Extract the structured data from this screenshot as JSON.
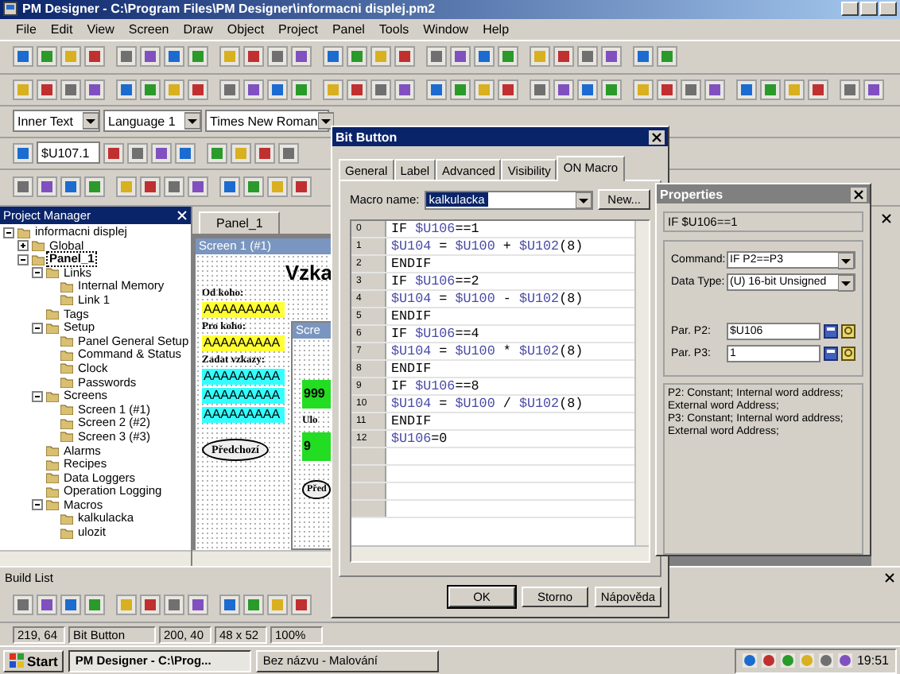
{
  "window": {
    "title": "PM Designer - C:\\Program Files\\PM Designer\\informacni displej.pm2"
  },
  "menu": [
    "File",
    "Edit",
    "View",
    "Screen",
    "Draw",
    "Object",
    "Project",
    "Panel",
    "Tools",
    "Window",
    "Help"
  ],
  "format_bar": {
    "text_target": "Inner Text",
    "language": "Language 1",
    "font": "Times New Roman"
  },
  "address_field": {
    "value": "$U107.1"
  },
  "project_manager": {
    "title": "Project Manager",
    "tree": [
      {
        "label": "informacni displej",
        "expanded": true,
        "selected": false,
        "children": [
          {
            "label": "Global",
            "expanded": false,
            "selected": false
          },
          {
            "label": "Panel_1",
            "expanded": true,
            "selected": true,
            "children": [
              {
                "label": "Links",
                "expanded": true,
                "selected": false,
                "children": [
                  {
                    "label": "Internal Memory",
                    "selected": false
                  },
                  {
                    "label": "Link 1",
                    "selected": false
                  }
                ]
              },
              {
                "label": "Tags",
                "selected": false
              },
              {
                "label": "Setup",
                "expanded": true,
                "selected": false,
                "children": [
                  {
                    "label": "Panel General Setup",
                    "selected": false
                  },
                  {
                    "label": "Command & Status",
                    "selected": false
                  },
                  {
                    "label": "Clock",
                    "selected": false
                  },
                  {
                    "label": "Passwords",
                    "selected": false
                  }
                ]
              },
              {
                "label": "Screens",
                "expanded": true,
                "selected": false,
                "children": [
                  {
                    "label": "Screen 1 (#1)",
                    "selected": false
                  },
                  {
                    "label": "Screen 2 (#2)",
                    "selected": false
                  },
                  {
                    "label": "Screen 3 (#3)",
                    "selected": false
                  }
                ]
              },
              {
                "label": "Alarms",
                "selected": false
              },
              {
                "label": "Recipes",
                "selected": false
              },
              {
                "label": "Data Loggers",
                "selected": false
              },
              {
                "label": "Operation Logging",
                "selected": false
              },
              {
                "label": "Macros",
                "expanded": true,
                "selected": false,
                "children": [
                  {
                    "label": "kalkulacka",
                    "selected": false
                  },
                  {
                    "label": "ulozit",
                    "selected": false
                  }
                ]
              }
            ]
          }
        ]
      }
    ]
  },
  "editor": {
    "tab": "Panel_1",
    "screen_title": "Screen 1 (#1)",
    "heading": "Vzka",
    "items": [
      {
        "kind": "label",
        "text": "Od koho:"
      },
      {
        "kind": "field",
        "text": "AAAAAAAAA",
        "color": "#ffff33"
      },
      {
        "kind": "label",
        "text": "Pro koho:"
      },
      {
        "kind": "field",
        "text": "AAAAAAAAA",
        "color": "#ffff33"
      },
      {
        "kind": "label",
        "text": "Zadat vzkazy:"
      },
      {
        "kind": "field",
        "text": "AAAAAAAAA",
        "color": "#33ffff"
      },
      {
        "kind": "field",
        "text": "AAAAAAAAA",
        "color": "#33ffff"
      },
      {
        "kind": "field",
        "text": "AAAAAAAAA",
        "color": "#33ffff"
      },
      {
        "kind": "button",
        "text": "Předchozí"
      }
    ],
    "inner_screen": {
      "title": "Scre",
      "items": [
        {
          "kind": "field",
          "text": "999",
          "color": "#22dd22"
        },
        {
          "kind": "label",
          "text": "Ulo"
        },
        {
          "kind": "field",
          "text": "9",
          "color": "#22dd22"
        },
        {
          "kind": "button",
          "text": "Před"
        }
      ]
    }
  },
  "dialog": {
    "title": "Bit Button",
    "tabs": [
      {
        "label": "General",
        "selected": false
      },
      {
        "label": "Label",
        "selected": false
      },
      {
        "label": "Advanced",
        "selected": false
      },
      {
        "label": "Visibility",
        "selected": false
      },
      {
        "label": "ON Macro",
        "selected": true
      }
    ],
    "macro_name_label": "Macro name:",
    "macro_name": "kalkulacka",
    "new_button": "New...",
    "lines": [
      {
        "number": "0",
        "code": "IF $U106==1"
      },
      {
        "number": "1",
        "code": "$U104 = $U100 + $U102(8)"
      },
      {
        "number": "2",
        "code": "ENDIF"
      },
      {
        "number": "3",
        "code": "IF $U106==2"
      },
      {
        "number": "4",
        "code": "$U104 = $U100 - $U102(8)"
      },
      {
        "number": "5",
        "code": "ENDIF"
      },
      {
        "number": "6",
        "code": "IF $U106==4"
      },
      {
        "number": "7",
        "code": "$U104 = $U100 * $U102(8)"
      },
      {
        "number": "8",
        "code": "ENDIF"
      },
      {
        "number": "9",
        "code": "IF $U106==8"
      },
      {
        "number": "10",
        "code": "$U104 = $U100 / $U102(8)"
      },
      {
        "number": "11",
        "code": "ENDIF"
      },
      {
        "number": "12",
        "code": "$U106=0"
      }
    ],
    "buttons": [
      "OK",
      "Storno",
      "Nápověda"
    ]
  },
  "properties": {
    "title": "Properties",
    "statement": "IF $U106==1",
    "command_label": "Command:",
    "command": "IF P2==P3",
    "data_type_label": "Data Type:",
    "data_type": "(U) 16-bit Unsigned",
    "p2_label": "Par. P2:",
    "p2": "$U106",
    "p3_label": "Par. P3:",
    "p3": "1",
    "help": [
      "P2: Constant; Internal word address; External word Address;",
      "P3: Constant; Internal word address; External word Address;"
    ]
  },
  "build_list": {
    "title": "Build List"
  },
  "status_bar": [
    "219, 64",
    "Bit Button",
    "200, 40",
    "48 x 52",
    "100%"
  ],
  "taskbar": {
    "start": "Start",
    "tasks": [
      {
        "label": "PM Designer - C:\\Prog...",
        "selected": true
      },
      {
        "label": "Bez názvu - Malování",
        "selected": false
      }
    ],
    "clock": "19:51"
  }
}
